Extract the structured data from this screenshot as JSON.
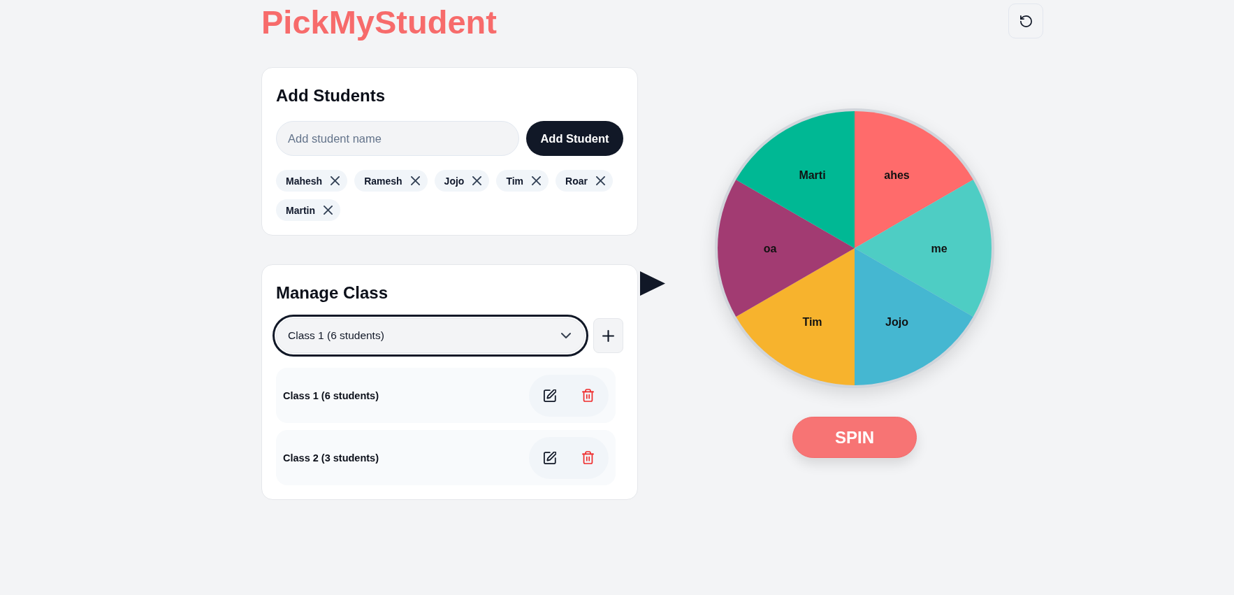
{
  "header": {
    "title": "PickMyStudent"
  },
  "add_students": {
    "heading": "Add Students",
    "name_field": {
      "placeholder": "Add student name"
    },
    "add_button": "Add Student",
    "students": [
      "Mahesh",
      "Ramesh",
      "Jojo",
      "Tim",
      "Roar",
      "Martin"
    ]
  },
  "manage_class": {
    "heading": "Manage Class",
    "class_select": {
      "value": "Class 1 (6 students)",
      "focused": true
    },
    "classes": [
      {
        "name": "Class 1 (6 students)"
      },
      {
        "name": "Class 2 (3 students)"
      }
    ]
  },
  "wheel": {
    "segments": [
      {
        "label": "ahes",
        "color": "#ff6b6b"
      },
      {
        "label": "me",
        "color": "#4ecdc4"
      },
      {
        "label": "Jojo",
        "color": "#45b7d1"
      },
      {
        "label": "Tim",
        "color": "#f7b32d"
      },
      {
        "label": "oa",
        "color": "#a23b72"
      },
      {
        "label": "Marti",
        "color": "#00b894"
      }
    ]
  },
  "spin_button": "SPIN"
}
